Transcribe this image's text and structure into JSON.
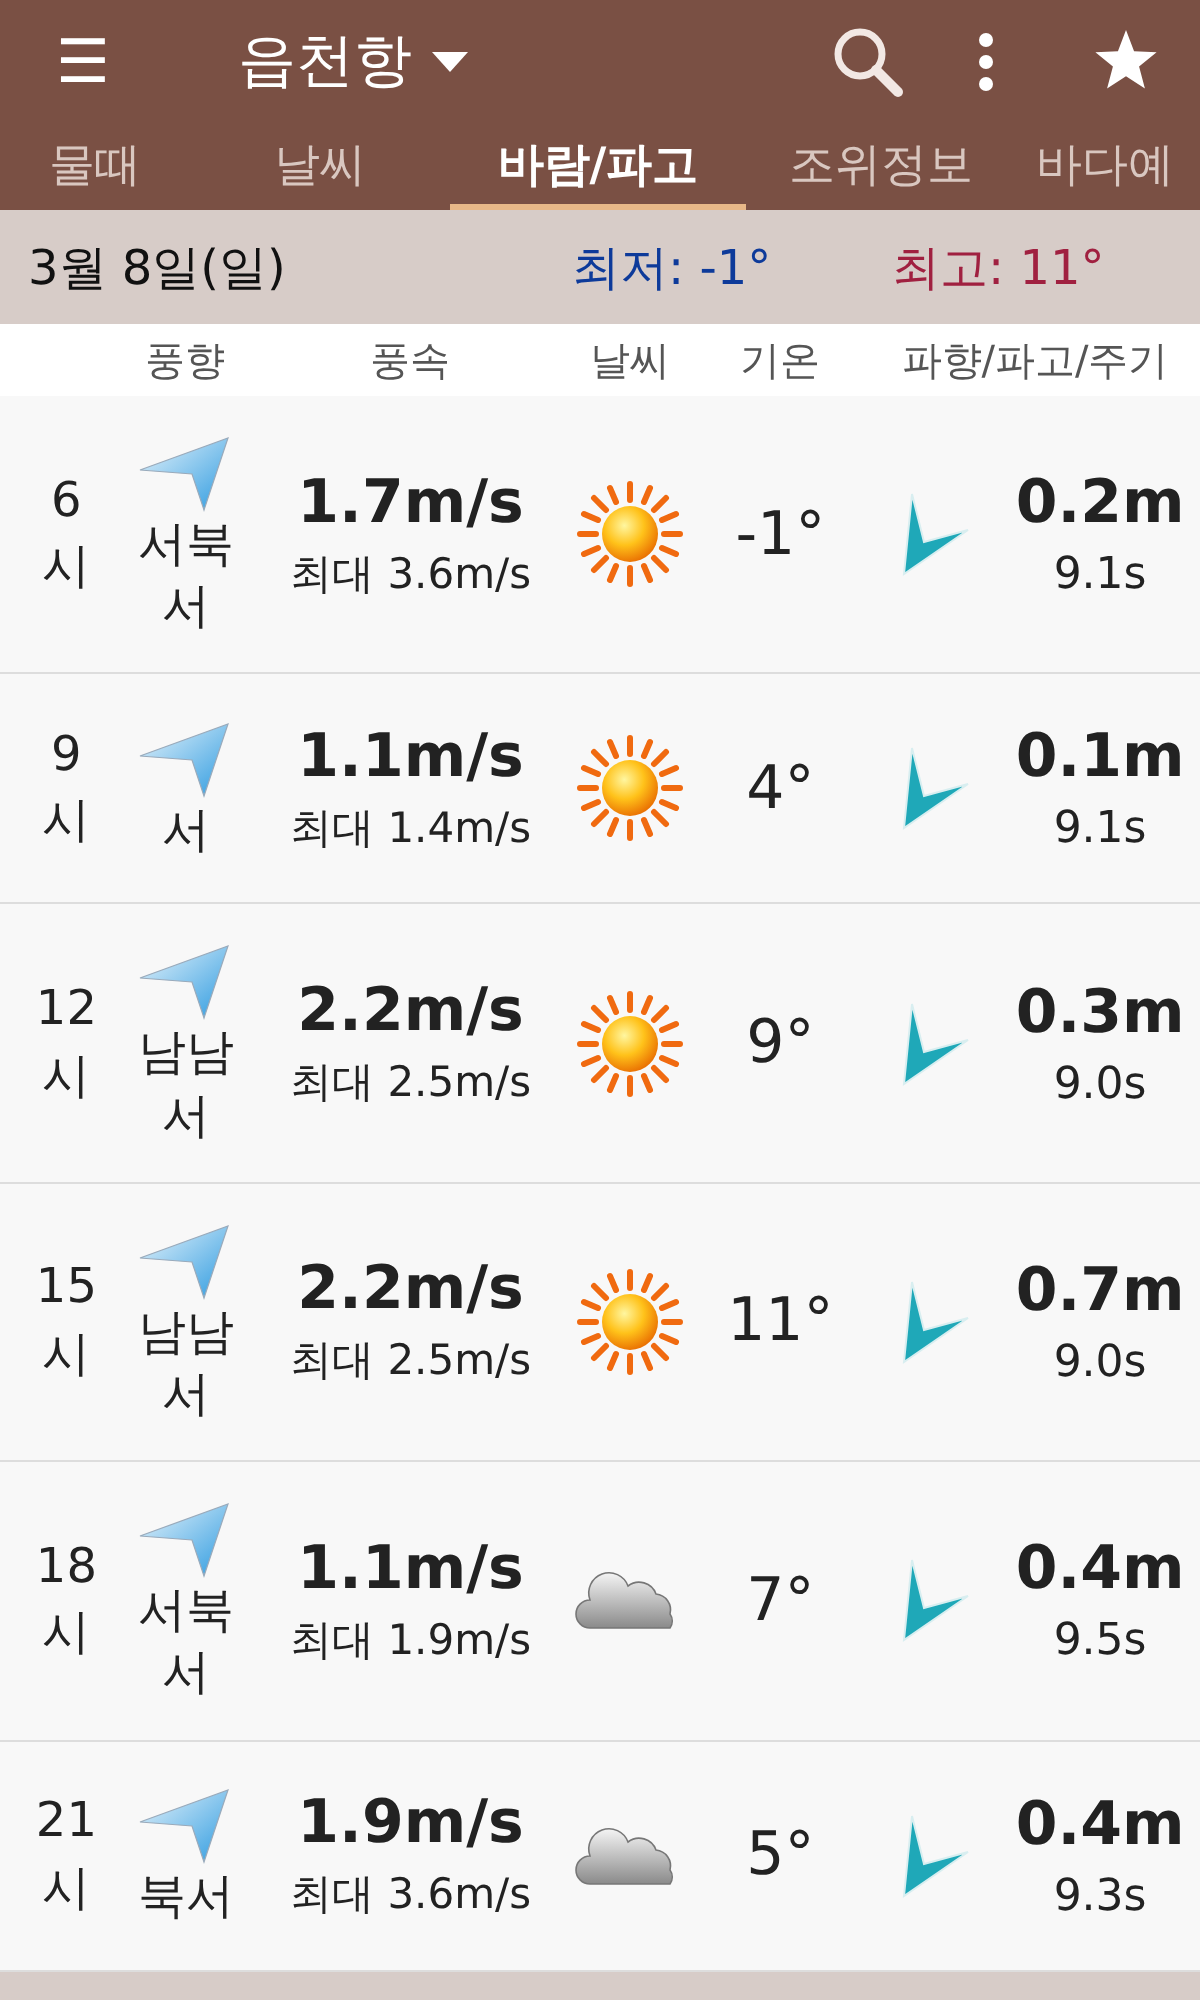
{
  "app_bar": {
    "menu_icon": "☰",
    "title": "읍천항"
  },
  "tabs": [
    {
      "label": "물때",
      "selected": false
    },
    {
      "label": "날씨",
      "selected": false
    },
    {
      "label": "바람/파고",
      "selected": true
    },
    {
      "label": "조위정보",
      "selected": false
    },
    {
      "label": "바다예",
      "selected": false
    }
  ],
  "day": {
    "date": "3월 8일(일)",
    "low": "최저: -1°",
    "high": "최고: 11°"
  },
  "columns": [
    "풍향",
    "풍속",
    "날씨",
    "기온",
    "파향/파고/주기"
  ],
  "rows": [
    {
      "time": "6시",
      "direction": "서북서",
      "speed": "1.7m/s",
      "max": "최대 3.6m/s",
      "kind": "sunny",
      "temp": "-1°",
      "wave": "0.2m",
      "period": "9.1s"
    },
    {
      "time": "9시",
      "direction": "서",
      "speed": "1.1m/s",
      "max": "최대 1.4m/s",
      "kind": "sunny",
      "temp": "4°",
      "wave": "0.1m",
      "period": "9.1s"
    },
    {
      "time": "12시",
      "direction": "남남서",
      "speed": "2.2m/s",
      "max": "최대 2.5m/s",
      "kind": "sunny",
      "temp": "9°",
      "wave": "0.3m",
      "period": "9.0s"
    },
    {
      "time": "15시",
      "direction": "남남서",
      "speed": "2.2m/s",
      "max": "최대 2.5m/s",
      "kind": "sunny",
      "temp": "11°",
      "wave": "0.7m",
      "period": "9.0s"
    },
    {
      "time": "18시",
      "direction": "서북서",
      "speed": "1.1m/s",
      "max": "최대 1.9m/s",
      "kind": "cloudy",
      "temp": "7°",
      "wave": "0.4m",
      "period": "9.5s"
    },
    {
      "time": "21시",
      "direction": "북서",
      "speed": "1.9m/s",
      "max": "최대 3.6m/s",
      "kind": "cloudy",
      "temp": "5°",
      "wave": "0.4m",
      "period": "9.3s"
    }
  ]
}
